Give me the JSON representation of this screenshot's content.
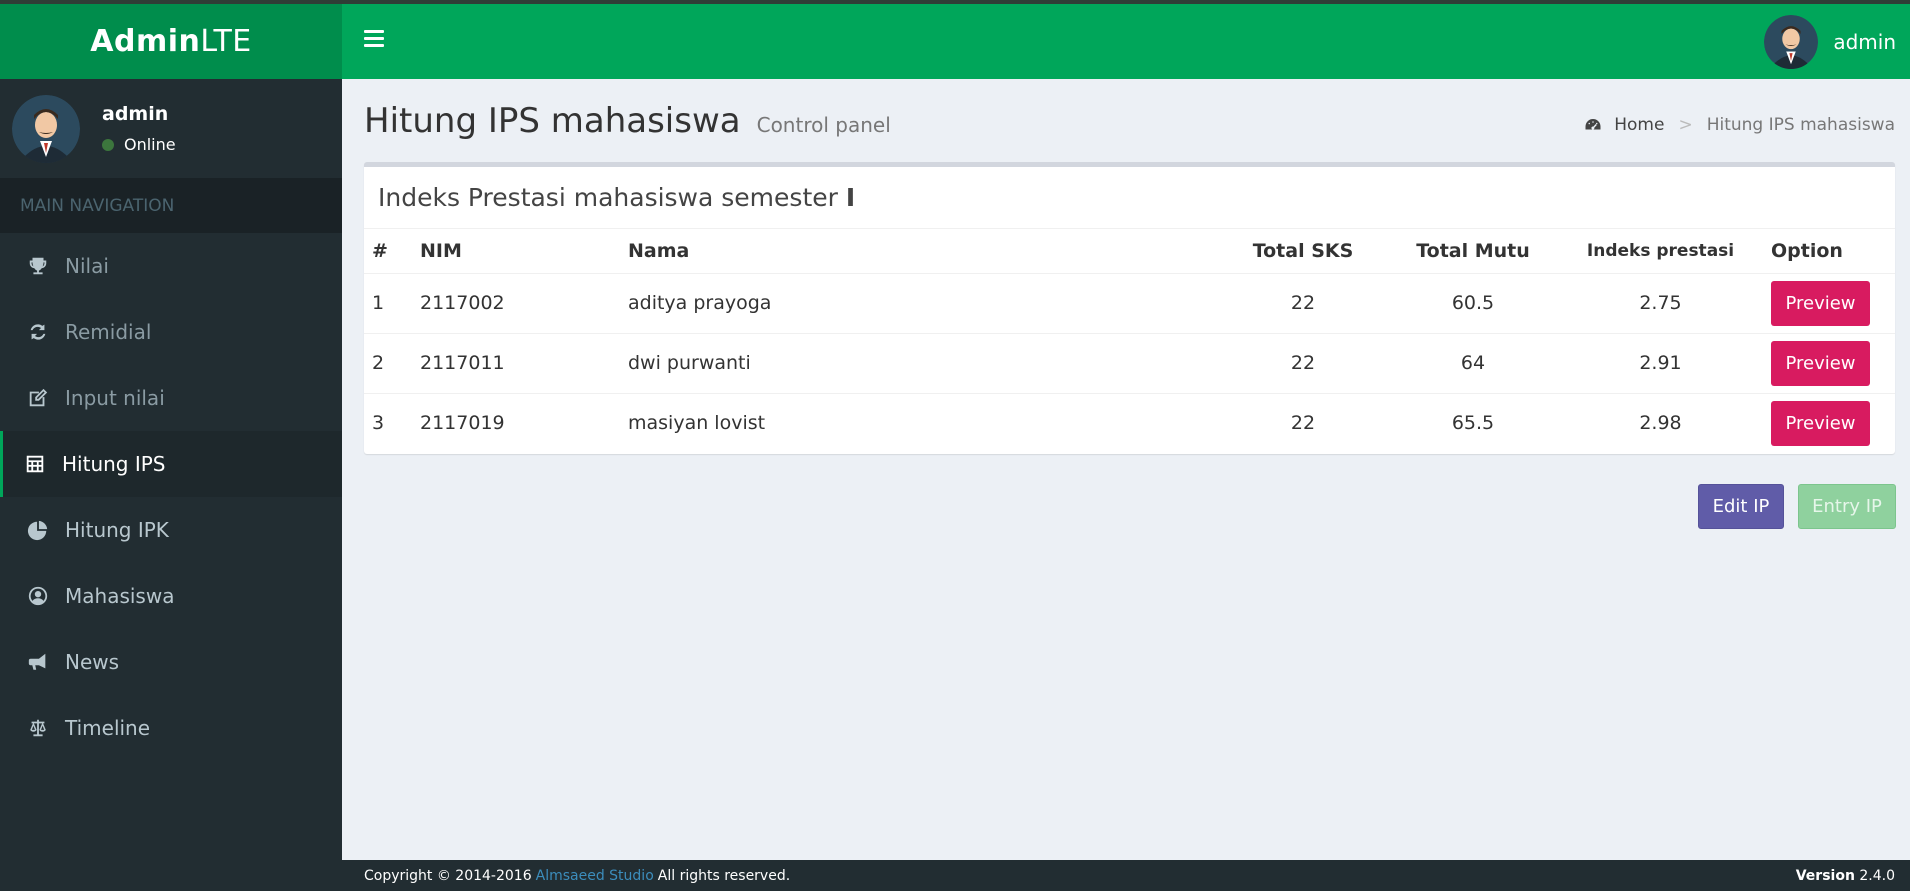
{
  "brand": {
    "bold": "Admin",
    "light": "LTE"
  },
  "header": {
    "username": "admin"
  },
  "sidebar": {
    "user": {
      "name": "admin",
      "status": "Online"
    },
    "nav_header": "MAIN NAVIGATION",
    "items": [
      {
        "label": "Nilai",
        "icon": "trophy-icon"
      },
      {
        "label": "Remidial",
        "icon": "refresh-icon"
      },
      {
        "label": "Input nilai",
        "icon": "edit-icon"
      },
      {
        "label": "Hitung IPS",
        "icon": "calculator-icon",
        "active": true
      },
      {
        "label": "Hitung IPK",
        "icon": "pie-chart-icon"
      },
      {
        "label": "Mahasiswa",
        "icon": "user-circle-icon"
      },
      {
        "label": "News",
        "icon": "bullhorn-icon"
      },
      {
        "label": "Timeline",
        "icon": "balance-scale-icon"
      }
    ]
  },
  "page": {
    "title": "Hitung IPS mahasiswa",
    "subtitle": "Control panel",
    "breadcrumb": {
      "home": "Home",
      "sep": ">",
      "current": "Hitung IPS mahasiswa"
    }
  },
  "box": {
    "title": "Indeks Prestasi mahasiswa semester",
    "title_suffix": "I"
  },
  "table": {
    "headers": [
      "#",
      "NIM",
      "Nama",
      "Total SKS",
      "Total Mutu",
      "Indeks prestasi",
      "Option"
    ],
    "rows": [
      [
        "1",
        "2117002",
        "aditya prayoga",
        "22",
        "60.5",
        "2.75"
      ],
      [
        "2",
        "2117011",
        "dwi purwanti",
        "22",
        "64",
        "2.91"
      ],
      [
        "3",
        "2117019",
        "masiyan lovist",
        "22",
        "65.5",
        "2.98"
      ]
    ],
    "preview_label": "Preview"
  },
  "actions": {
    "edit": "Edit IP",
    "entry": "Entry IP"
  },
  "footer": {
    "copyright": "Copyright © 2014-2016",
    "company": "Almsaeed Studio",
    "rights": "All rights reserved.",
    "version_label": "Version",
    "version": "2.4.0"
  },
  "colors": {
    "header": "#00a65a",
    "logo": "#008d4c",
    "sidebar": "#222d32",
    "preview_button": "#d81b60",
    "edit_button": "#605ca8",
    "entry_button": "#8fd19e"
  }
}
